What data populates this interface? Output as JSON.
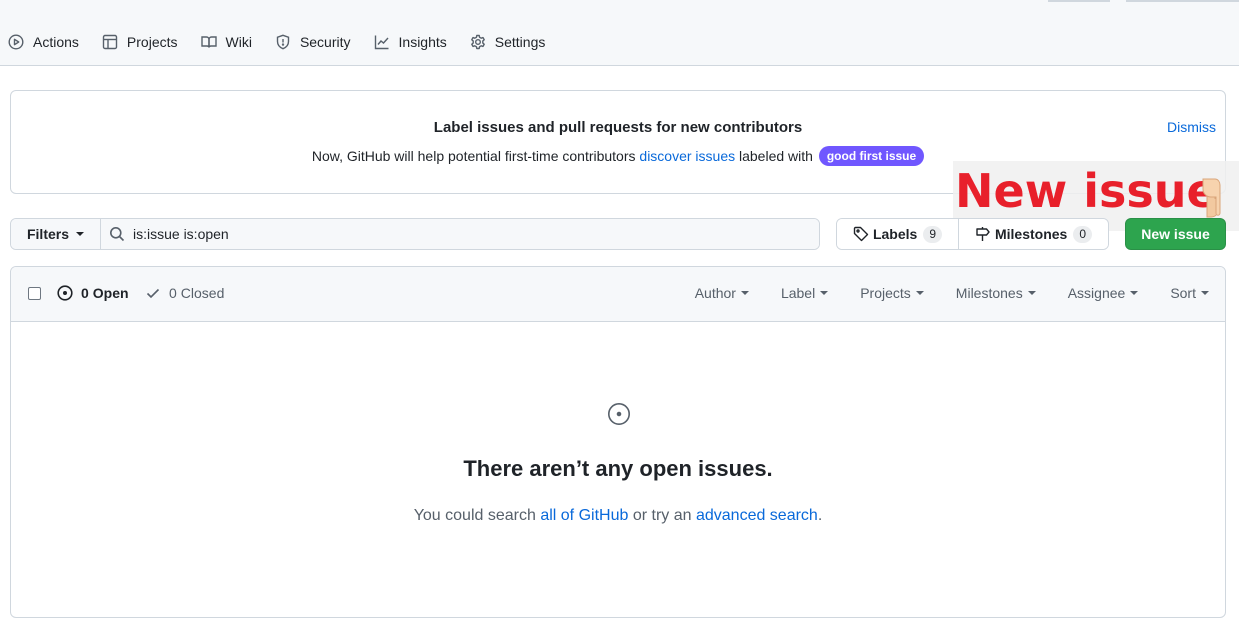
{
  "nav": {
    "items": [
      {
        "label": "Actions",
        "icon": "play-circle-icon"
      },
      {
        "label": "Projects",
        "icon": "table-icon"
      },
      {
        "label": "Wiki",
        "icon": "book-icon"
      },
      {
        "label": "Security",
        "icon": "shield-icon"
      },
      {
        "label": "Insights",
        "icon": "graph-icon"
      },
      {
        "label": "Settings",
        "icon": "gear-icon"
      }
    ]
  },
  "banner": {
    "title": "Label issues and pull requests for new contributors",
    "text_before": "Now, GitHub will help potential first-time contributors",
    "link": "discover issues",
    "text_after": "labeled with",
    "label": "good first issue",
    "label_color": "#7057ff",
    "dismiss": "Dismiss"
  },
  "annotation": {
    "text": "New issue",
    "color": "#e8202b"
  },
  "filters": {
    "button": "Filters",
    "search_value": "is:issue is:open"
  },
  "labels_button": {
    "label": "Labels",
    "count": "9"
  },
  "milestones_button": {
    "label": "Milestones",
    "count": "0"
  },
  "new_issue_button": {
    "label": "New issue",
    "color": "#2da44e"
  },
  "issues": {
    "open_count": "0",
    "open_label": "Open",
    "closed_count": "0",
    "closed_label": "Closed",
    "sort_menus": [
      "Author",
      "Label",
      "Projects",
      "Milestones",
      "Assignee",
      "Sort"
    ],
    "empty_title": "There aren’t any open issues.",
    "empty_text_before": "You could search",
    "empty_link_1": "all of GitHub",
    "empty_text_middle": "or try an",
    "empty_link_2": "advanced search",
    "empty_text_after": "."
  }
}
